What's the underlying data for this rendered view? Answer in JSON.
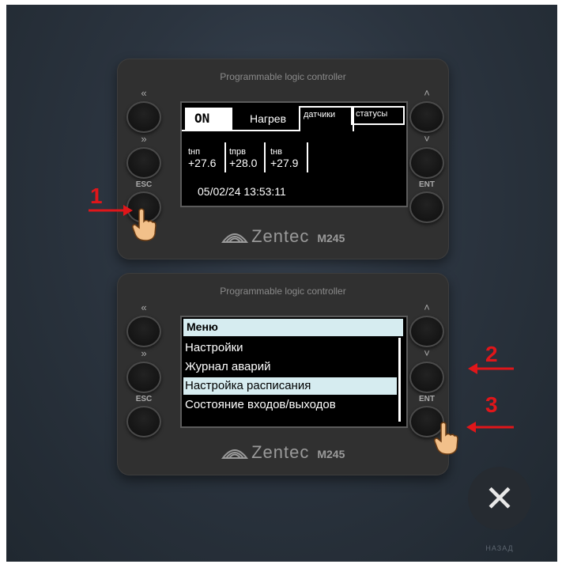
{
  "plc_title": "Programmable logic controller",
  "brand": "Zentec",
  "model": "M245",
  "buttons": {
    "left": [
      "«",
      "»",
      "ESC"
    ],
    "right": [
      "˄",
      "˅",
      "ENT"
    ]
  },
  "screen1": {
    "status": "ON",
    "mode": "Нагрев",
    "tabs": [
      "датчики",
      "статусы"
    ],
    "sensors": [
      {
        "name": "tнп",
        "value": "+27.6"
      },
      {
        "name": "tпрв",
        "value": "+28.0"
      },
      {
        "name": "tнв",
        "value": "+27.9"
      }
    ],
    "datetime": "05/02/24 13:53:11"
  },
  "screen2": {
    "menu_title": "Меню",
    "items": [
      "Настройки",
      "Журнал аварий",
      "Настройка расписания",
      "Состояние входов/выходов"
    ],
    "selected_index": 2
  },
  "steps": [
    "1",
    "2",
    "3"
  ],
  "close_label": "НАЗАД",
  "colors": {
    "accent_red": "#e0161a",
    "highlight": "#d6ecf0"
  }
}
